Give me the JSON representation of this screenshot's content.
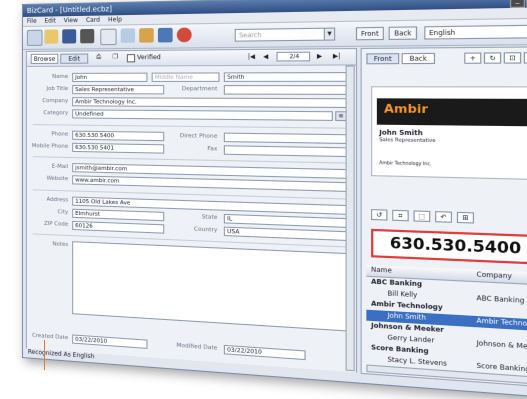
{
  "title": "BizCard - [Untitled.ecbz]",
  "menu": [
    "File",
    "Edit",
    "View",
    "Card",
    "Help"
  ],
  "toolbar": {
    "search_placeholder": "Search",
    "front": "Front",
    "back": "Back",
    "language": "English"
  },
  "nav": {
    "browse": "Browse",
    "edit": "Edit",
    "verified": "Verified",
    "page": "2/4"
  },
  "form": {
    "name_label": "Name",
    "first_name": "John",
    "middle_placeholder": "Middle Name",
    "last_name": "Smith",
    "jobtitle_label": "Job Title",
    "job_title": "Sales Representative",
    "department_label": "Department",
    "company_label": "Company",
    "company": "Ambir Technology Inc.",
    "category_label": "Category",
    "category": "Undefined",
    "phone_label": "Phone",
    "phone": "630.530.5400",
    "direct_label": "Direct Phone",
    "mobile_label": "Mobile Phone",
    "mobile": "630.530.5401",
    "fax_label": "Fax",
    "email_label": "E-Mail",
    "email": "jsmith@ambir.com",
    "website_label": "Website",
    "website": "www.ambir.com",
    "address_label": "Address",
    "address": "1105 Old Lakes Ave",
    "city_label": "City",
    "city": "Elmhurst",
    "state_label": "State",
    "state": "IL",
    "zip_label": "ZIP Code",
    "zip": "60126",
    "country_label": "Country",
    "country": "USA",
    "notes_label": "Notes",
    "created_label": "Created Date",
    "created": "03/22/2010",
    "modified_label": "Modified Date",
    "modified": "03/22/2010"
  },
  "status": "Recognized As English",
  "right": {
    "front_tab": "Front",
    "back_tab": "Back",
    "card_name": "John Smith",
    "card_title": "Sales Representative",
    "card_company": "Ambir Technology Inc.",
    "big_phone": "630.530.5400",
    "list_col_name": "Name",
    "list_col_company": "Company",
    "rows": [
      {
        "name": "ABC Banking",
        "company": "",
        "group": true
      },
      {
        "name": "Bill Kelly",
        "company": "ABC Banking",
        "group": false
      },
      {
        "name": "Ambir Technology",
        "company": "",
        "group": true
      },
      {
        "name": "John Smith",
        "company": "Ambir Technology",
        "group": false,
        "selected": true
      },
      {
        "name": "Johnson & Meeker",
        "company": "",
        "group": true
      },
      {
        "name": "Gerry Lander",
        "company": "Johnson & Meeker",
        "group": false
      },
      {
        "name": "Score Banking",
        "company": "",
        "group": true
      },
      {
        "name": "Stacy L. Stevens",
        "company": "Score Banking",
        "group": false
      }
    ]
  },
  "colors": {
    "accent": "#3b6fc3",
    "phone_border": "#e23b3b",
    "logo": "#f7941d"
  }
}
